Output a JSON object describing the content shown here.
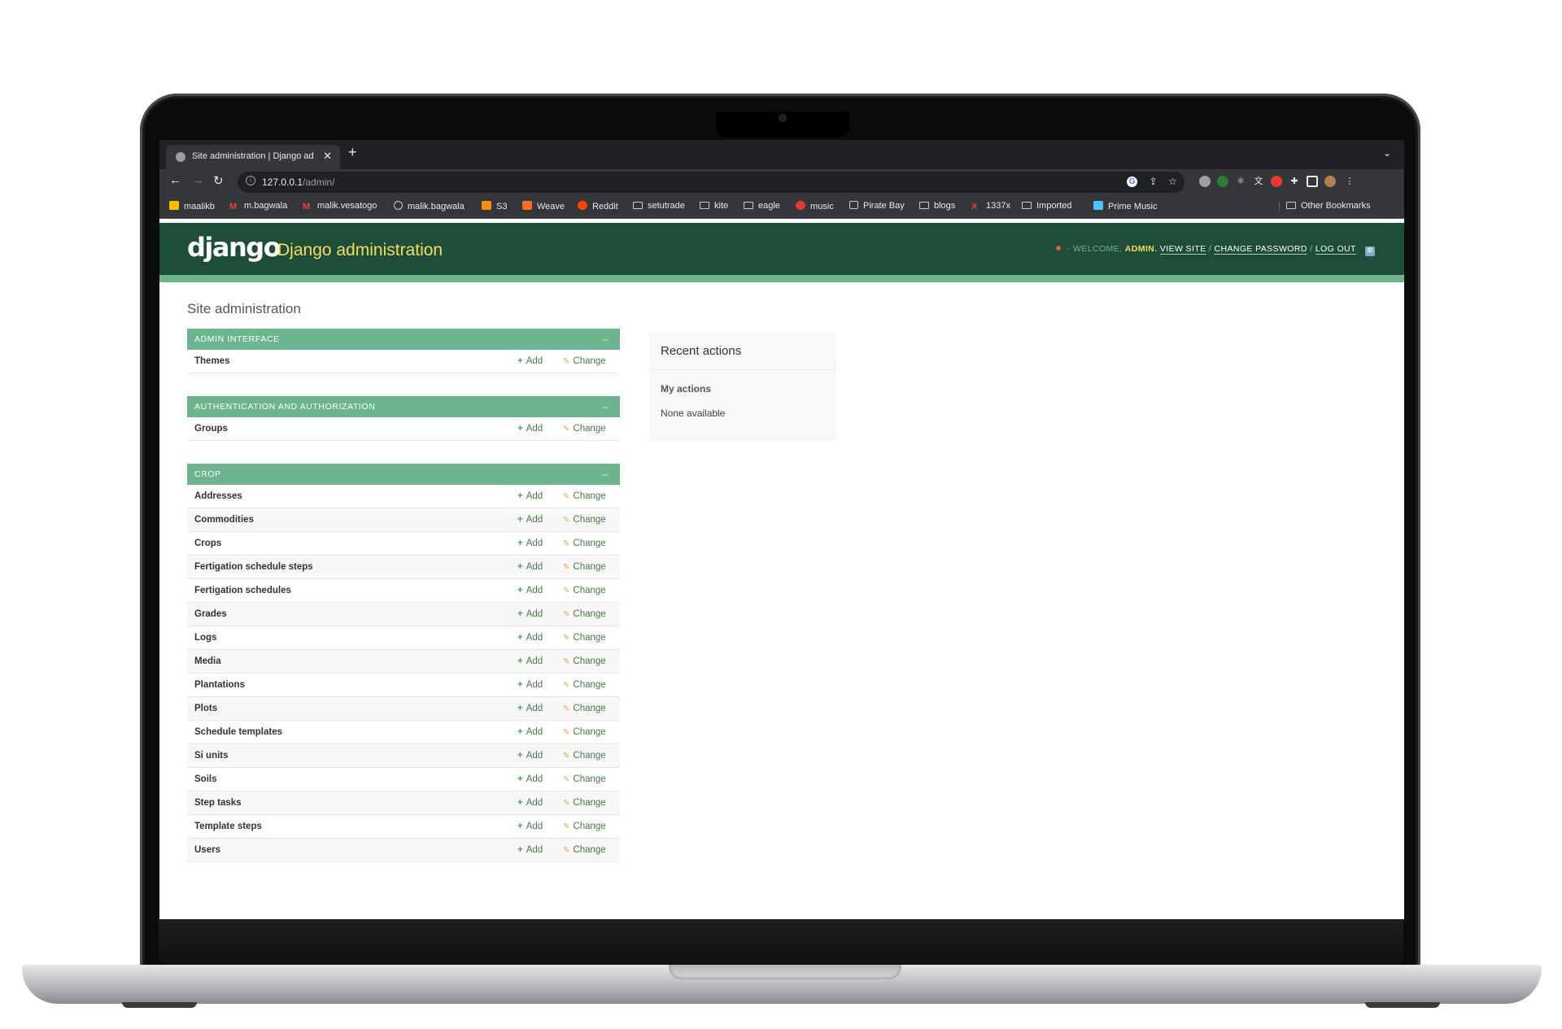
{
  "browser": {
    "tab_title": "Site administration | Django ad",
    "url_host": "127.0.0.1",
    "url_path": "/admin/",
    "bookmarks": [
      "maalikb",
      "m.bagwala",
      "malik.vesatogo",
      "malik.bagwala",
      "S3",
      "Weave",
      "Reddit",
      "setutrade",
      "kite",
      "eagle",
      "music",
      "Pirate Bay",
      "blogs",
      "1337x",
      "Imported",
      "Prime Music"
    ],
    "other_bookmarks": "Other Bookmarks"
  },
  "header": {
    "logo": "django",
    "site_title": "Django administration",
    "welcome_prefix": "- WELCOME,",
    "user": "ADMIN.",
    "view_site": "VIEW SITE",
    "change_password": "CHANGE PASSWORD",
    "log_out": "LOG OUT"
  },
  "page_title": "Site administration",
  "modules": [
    {
      "caption": "Admin Interface",
      "models": [
        "Themes"
      ]
    },
    {
      "caption": "Authentication and Authorization",
      "models": [
        "Groups"
      ]
    },
    {
      "caption": "Crop",
      "models": [
        "Addresses",
        "Commodities",
        "Crops",
        "Fertigation schedule steps",
        "Fertigation schedules",
        "Grades",
        "Logs",
        "Media",
        "Plantations",
        "Plots",
        "Schedule templates",
        "Si units",
        "Soils",
        "Step tasks",
        "Template steps",
        "Users"
      ]
    }
  ],
  "actions": {
    "add": "Add",
    "change": "Change",
    "collapse": "–"
  },
  "recent_actions": {
    "title": "Recent actions",
    "my_actions": "My actions",
    "none": "None available"
  }
}
